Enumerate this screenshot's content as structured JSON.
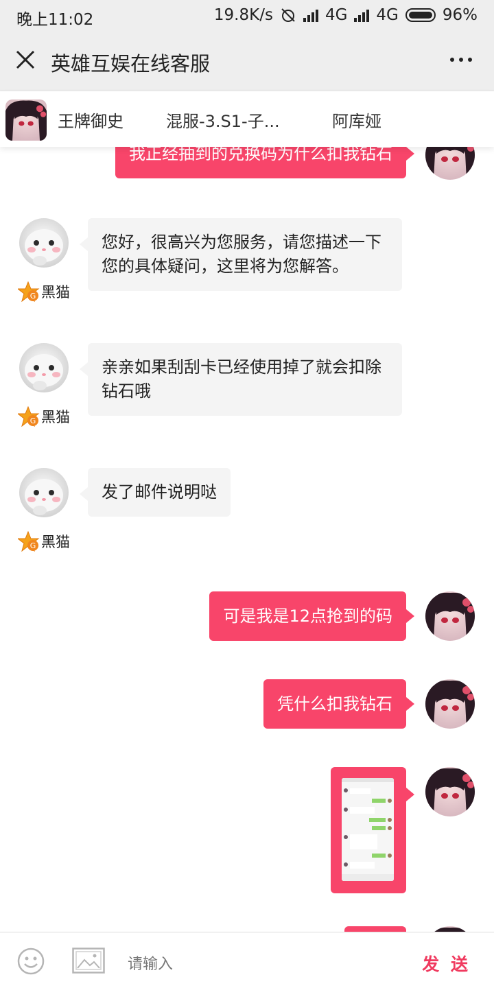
{
  "status_bar": {
    "time": "晚上11:02",
    "net_speed": "19.8K/s",
    "network_1": "4G",
    "network_2": "4G",
    "battery": "96%"
  },
  "title_bar": {
    "title": "英雄互娱在线客服"
  },
  "info_bar": {
    "game": "王牌御史",
    "server": "混服-3.S1-子...",
    "character": "阿库娅"
  },
  "messages": [
    {
      "side": "right",
      "text": "我正经抽到的兑换码为什么扣我钻石"
    },
    {
      "side": "left",
      "agent": "黑猫",
      "text": "您好，很高兴为您服务，请您描述一下您的具体疑问，这里将为您解答。"
    },
    {
      "side": "left",
      "agent": "黑猫",
      "text": "亲亲如果刮刮卡已经使用掉了就会扣除钻石哦"
    },
    {
      "side": "left",
      "agent": "黑猫",
      "text": "发了邮件说明哒"
    },
    {
      "side": "right",
      "text": "可是我是12点抢到的码"
    },
    {
      "side": "right",
      "text": "凭什么扣我钻石"
    },
    {
      "side": "right",
      "type": "image"
    }
  ],
  "input_bar": {
    "placeholder": "请输入",
    "send_label": "发 送"
  },
  "colors": {
    "accent": "#f8456a",
    "send": "#f03a5f",
    "bubble_left": "#f4f4f4",
    "header_bg": "#eeeeee"
  },
  "icons": [
    "close-icon",
    "more-icon",
    "emoji-icon",
    "image-icon",
    "star-badge-icon"
  ]
}
